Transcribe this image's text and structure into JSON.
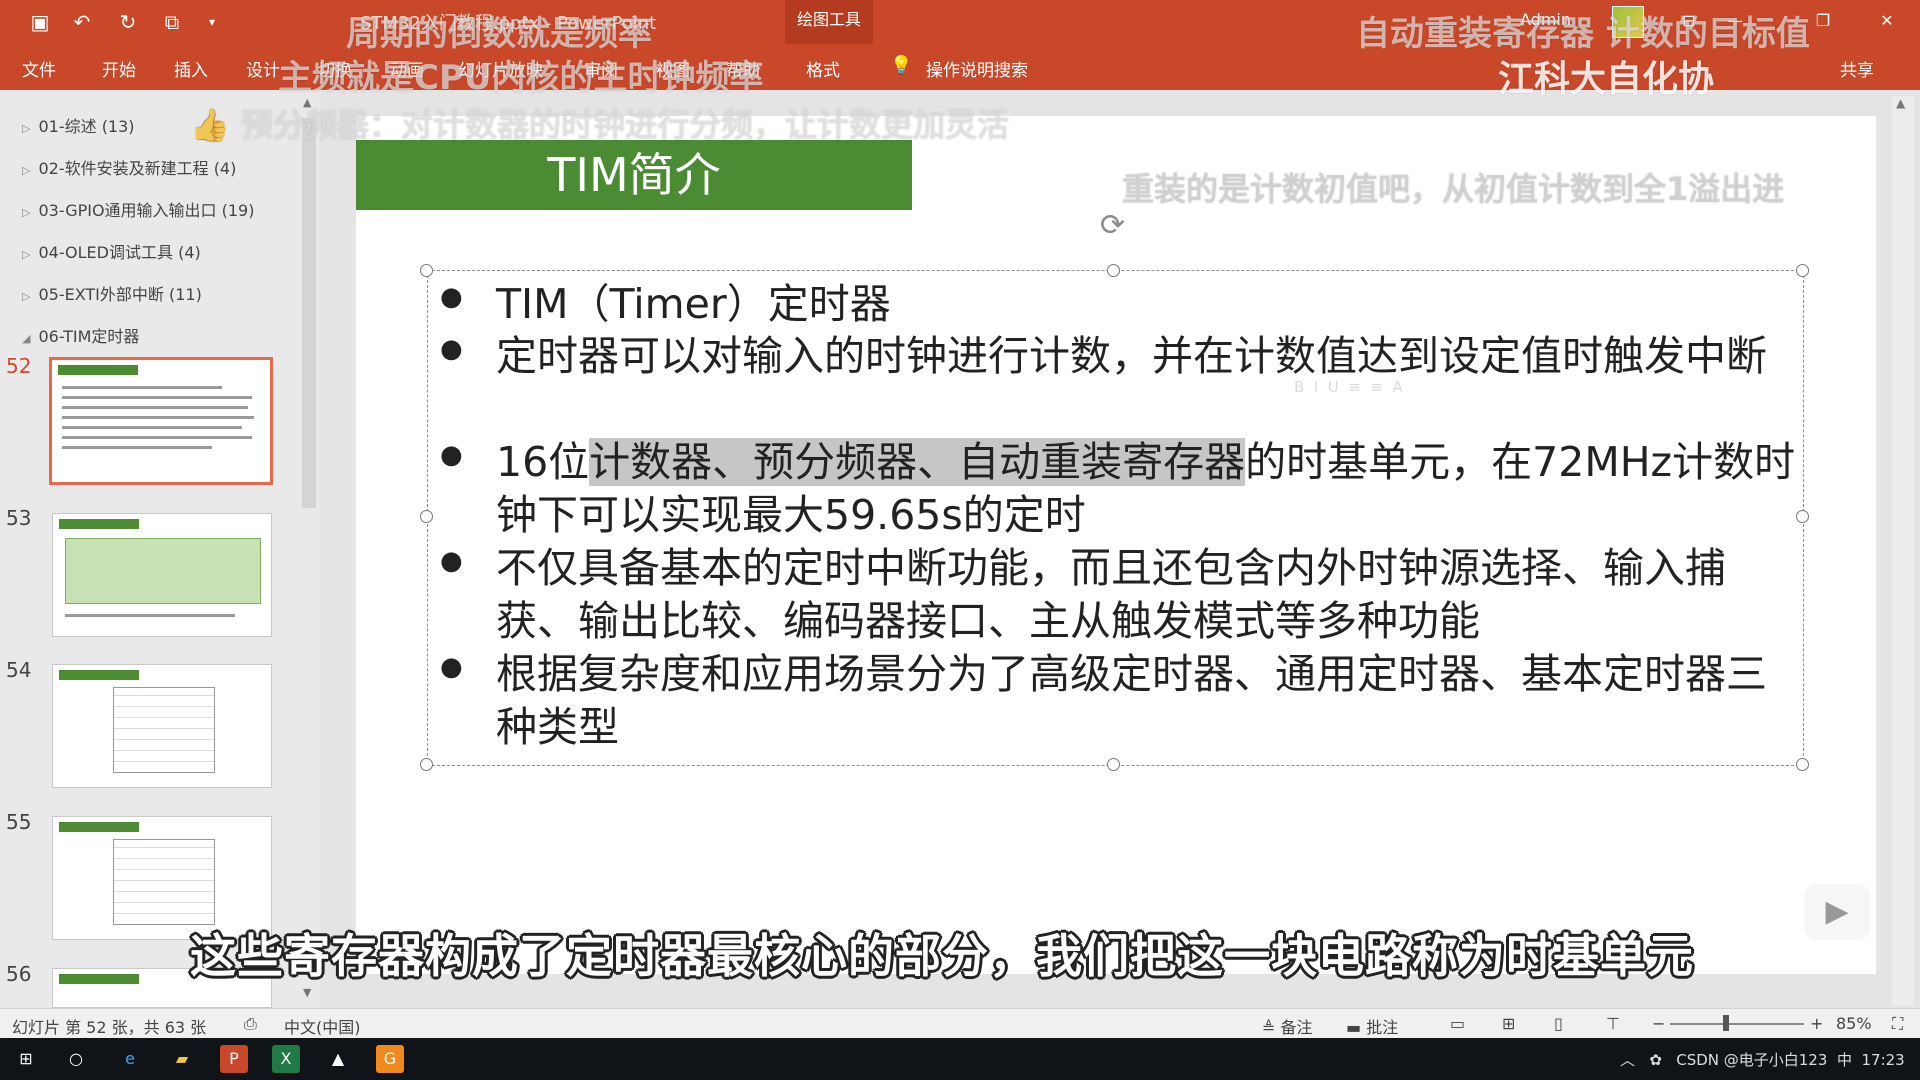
{
  "titlebar": {
    "doc_title": "STM32入门教程.pptx - PowerPoint",
    "contextual_tab": "绘图工具",
    "user": "Admin",
    "icons": [
      "save-icon",
      "undo-icon",
      "redo-icon",
      "present-icon",
      "customize-icon"
    ]
  },
  "menu": {
    "items": [
      "文件",
      "开始",
      "插入",
      "设计",
      "切换",
      "动画",
      "幻灯片放映",
      "审阅",
      "视图",
      "帮助",
      "格式"
    ],
    "tell_me": "操作说明搜索",
    "share": "共享"
  },
  "sections": [
    {
      "label": "01-综述 (13)"
    },
    {
      "label": "02-软件安装及新建工程 (4)"
    },
    {
      "label": "03-GPIO通用输入输出口 (19)"
    },
    {
      "label": "04-OLED调试工具 (4)"
    },
    {
      "label": "05-EXTI外部中断 (11)"
    },
    {
      "label": "06-TIM定时器"
    }
  ],
  "thumbnails": [
    {
      "num": "52",
      "kind": "text",
      "active": true
    },
    {
      "num": "53",
      "kind": "table",
      "active": false
    },
    {
      "num": "54",
      "kind": "diagram",
      "active": false
    },
    {
      "num": "55",
      "kind": "diagram",
      "active": false
    },
    {
      "num": "56",
      "kind": "text",
      "active": false
    }
  ],
  "slide": {
    "title": "TIM简介",
    "bullets": [
      {
        "pre": "TIM（Timer）定时器",
        "hl": "",
        "post": ""
      },
      {
        "pre": "定时器可以对输入的时钟进行计数，并在计数值达到设定值时触发中断",
        "hl": "",
        "post": ""
      },
      {
        "pre": "16位",
        "hl": "计数器、预分频器、自动重装寄存器",
        "post": "的时基单元，在72MHz计数时钟下可以实现最大59.65s的定时"
      },
      {
        "pre": "不仅具备基本的定时中断功能，而且还包含内外时钟源选择、输入捕获、输出比较、编码器接口、主从触发模式等多种功能",
        "hl": "",
        "post": ""
      },
      {
        "pre": "根据复杂度和应用场景分为了高级定时器、通用定时器、基本定时器三种类型",
        "hl": "",
        "post": ""
      }
    ]
  },
  "overlays": {
    "top_left": "周期的倒数就是频率",
    "top_right": "自动重装寄存器   计数的目标值",
    "second_line": "主频就是CPU内核的主时钟频率",
    "brand": "江科大自化协",
    "third_line": "预分频器：对计数器的时钟进行分频，让计数更加灵活",
    "right_comment": "重装的是计数初值吧，从初值计数到全1溢出进",
    "subtitle": "这些寄存器构成了定时器最核心的部分，我们把这一块电路称为时基单元"
  },
  "status": {
    "slide_info": "幻灯片 第 52 张，共 63 张",
    "language": "中文(中国)",
    "notes": "备注",
    "comments": "批注",
    "zoom": "85%",
    "zoom_level_percent": 85
  },
  "taskbar": {
    "tray_text": "CSDN @电子小白123",
    "ime": "中",
    "clock": "17:23"
  },
  "colors": {
    "ribbon": "#c9482a",
    "title_green": "#4a8b33",
    "active_thumb_border": "#e7694a"
  }
}
